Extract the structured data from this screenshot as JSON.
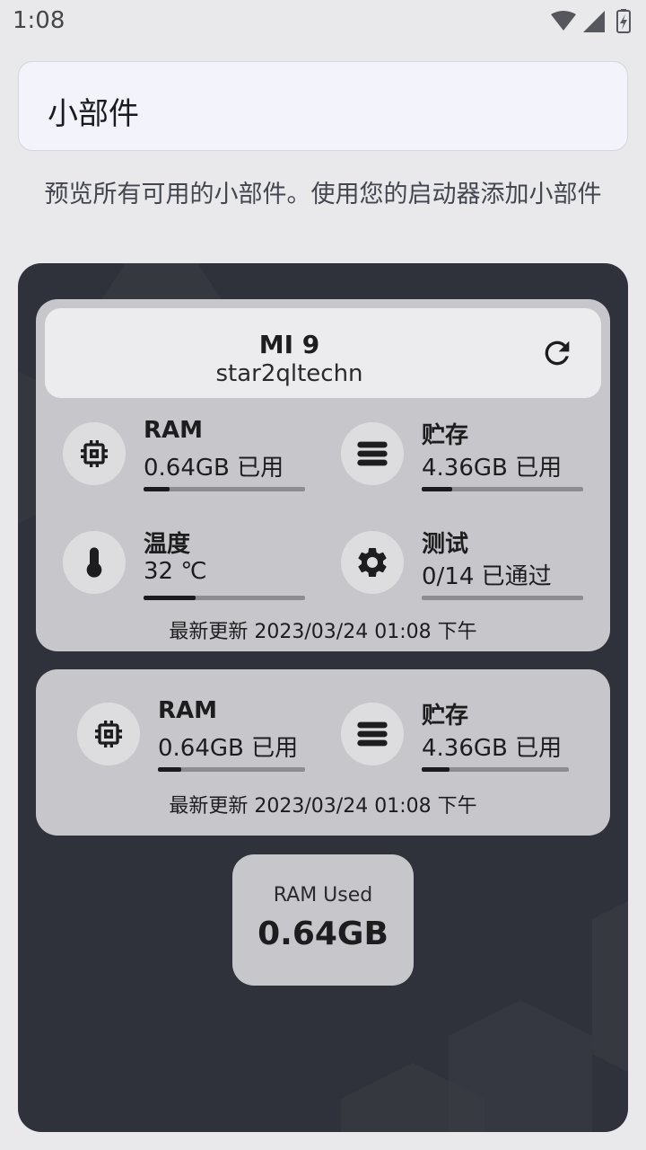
{
  "status_bar": {
    "time": "1:08",
    "icons": [
      "wifi-icon",
      "cell-signal-icon",
      "battery-charging-icon"
    ]
  },
  "header": {
    "title": "小部件"
  },
  "description": "预览所有可用的小部件。使用您的启动器添加小部件",
  "widget_large": {
    "device_name": "MI 9",
    "device_model": "star2qltechn",
    "refresh_icon": "refresh-icon",
    "stats": [
      {
        "label": "RAM",
        "value": "0.64GB 已用",
        "icon": "chip-icon",
        "progress": 0.16
      },
      {
        "label": "贮存",
        "value": "4.36GB 已用",
        "icon": "storage-icon",
        "progress": 0.19
      },
      {
        "label": "温度",
        "value": "32 ℃",
        "icon": "thermometer-icon",
        "progress": 0.32
      },
      {
        "label": "测试",
        "value": "0/14 已通过",
        "icon": "gear-icon",
        "progress": 0.0
      }
    ],
    "updated": "最新更新 2023/03/24 01:08 下午"
  },
  "widget_medium": {
    "stats": [
      {
        "label": "RAM",
        "value": "0.64GB 已用",
        "icon": "chip-icon",
        "progress": 0.16
      },
      {
        "label": "贮存",
        "value": "4.36GB 已用",
        "icon": "storage-icon",
        "progress": 0.19
      }
    ],
    "updated": "最新更新 2023/03/24 01:08 下午"
  },
  "widget_small": {
    "label": "RAM Used",
    "value": "0.64GB"
  },
  "colors": {
    "page_bg": "#e9e9ec",
    "preview_bg": "#30323b",
    "widget_bg": "#c7c7cb",
    "bar_fill": "#1b1b1d"
  }
}
